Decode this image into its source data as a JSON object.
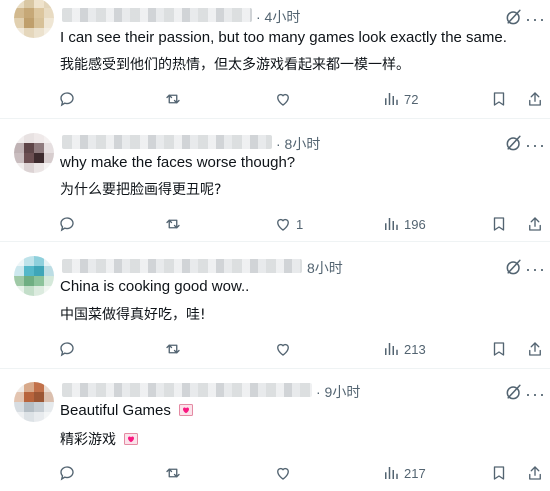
{
  "replies": [
    {
      "time": "· 4小时",
      "text_en": "I can see their passion, but too many games look exactly the same.",
      "text_zh": "我能感受到他们的热情，但太多游戏看起来都一模一样。",
      "replies_count": "",
      "retweets_count": "",
      "likes_count": "",
      "views_count": "72"
    },
    {
      "time": "· 8小时",
      "text_en": "why make the faces worse though?",
      "text_zh": "为什么要把脸画得更丑呢?",
      "replies_count": "",
      "retweets_count": "",
      "likes_count": "1",
      "views_count": "196"
    },
    {
      "time": "8小时",
      "text_en": "China is cooking good wow..",
      "text_zh": "中国菜做得真好吃，哇!",
      "replies_count": "",
      "retweets_count": "",
      "likes_count": "",
      "views_count": "213"
    },
    {
      "time": "· 9小时",
      "text_en": "Beautiful Games",
      "text_zh": "精彩游戏",
      "replies_count": "",
      "retweets_count": "",
      "likes_count": "",
      "views_count": "217"
    }
  ],
  "more_label": "···",
  "icons": [
    "reply-icon",
    "retweet-icon",
    "like-icon",
    "views-icon",
    "bookmark-icon",
    "share-icon",
    "grok-icon",
    "heart-letter-emoji"
  ],
  "colors": {
    "text": "#0f1419",
    "secondary": "#536471",
    "divider": "#eff3f4",
    "emoji_heart": "#f91880"
  }
}
